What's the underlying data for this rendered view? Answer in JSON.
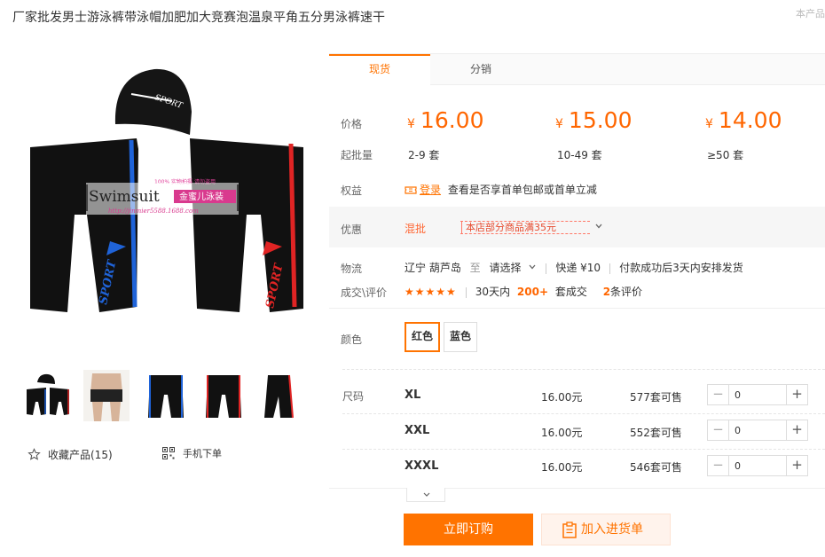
{
  "product": {
    "title": "厂家批发男士游泳裤带泳帽加肥加大竞赛泡温泉平角五分男泳裤速干",
    "corner_note": "本产品"
  },
  "gallery": {
    "main_image": {
      "cap_text": "SPORT",
      "trunk_text": "SPORT",
      "watermark_line1": "100% 实物拍摄 请勿盗用",
      "watermark_brand": "Swimsuit",
      "watermark_chinese": "金蜜儿泳装",
      "watermark_url": "http://jinmier5588.1688.com"
    },
    "thumbnails": [
      "swim-cap-and-trunks",
      "model-wearing-trunks",
      "trunks-blue",
      "trunks-red",
      "trunks-side"
    ],
    "favorite_label": "收藏产品(15)",
    "mobile_order_label": "手机下单"
  },
  "tabs": [
    {
      "label": "现货",
      "active": true
    },
    {
      "label": "分销",
      "active": false
    }
  ],
  "pricing": {
    "price_label": "价格",
    "moq_label": "起批量",
    "currency": "¥",
    "tiers": [
      {
        "price": "16.00",
        "range": "2-9 套"
      },
      {
        "price": "15.00",
        "range": "10-49 套"
      },
      {
        "price": "14.00",
        "range": "≥50 套"
      }
    ]
  },
  "rights": {
    "label": "权益",
    "login_link": "登录",
    "text": "查看是否享首单包邮或首单立减"
  },
  "promotion": {
    "label": "优惠",
    "tag": "混批",
    "coupon": "本店部分商品满35元"
  },
  "logistics": {
    "label": "物流",
    "origin": "辽宁 葫芦岛",
    "to": "至",
    "destination": "请选择",
    "shipping": "快递 ¥10",
    "dispatch": "付款成功后3天内安排发货"
  },
  "deals": {
    "label": "成交\\评价",
    "stars": "★★★★★",
    "period": "30天内",
    "count": "200+",
    "unit": "套成交",
    "reviews_count": "2",
    "reviews_text": "条评价"
  },
  "colors": {
    "label": "颜色",
    "options": [
      {
        "label": "红色",
        "selected": true
      },
      {
        "label": "蓝色",
        "selected": false
      }
    ]
  },
  "sizes": {
    "label": "尺码",
    "rows": [
      {
        "name": "XL",
        "price": "16.00元",
        "stock": "577套可售",
        "qty": "0"
      },
      {
        "name": "XXL",
        "price": "16.00元",
        "stock": "552套可售",
        "qty": "0"
      },
      {
        "name": "XXXL",
        "price": "16.00元",
        "stock": "546套可售",
        "qty": "0"
      }
    ]
  },
  "actions": {
    "buy_now": "立即订购",
    "add_to_cart": "加入进货单"
  },
  "theme": {
    "accent": "#ff7300",
    "price": "#ff6600"
  }
}
